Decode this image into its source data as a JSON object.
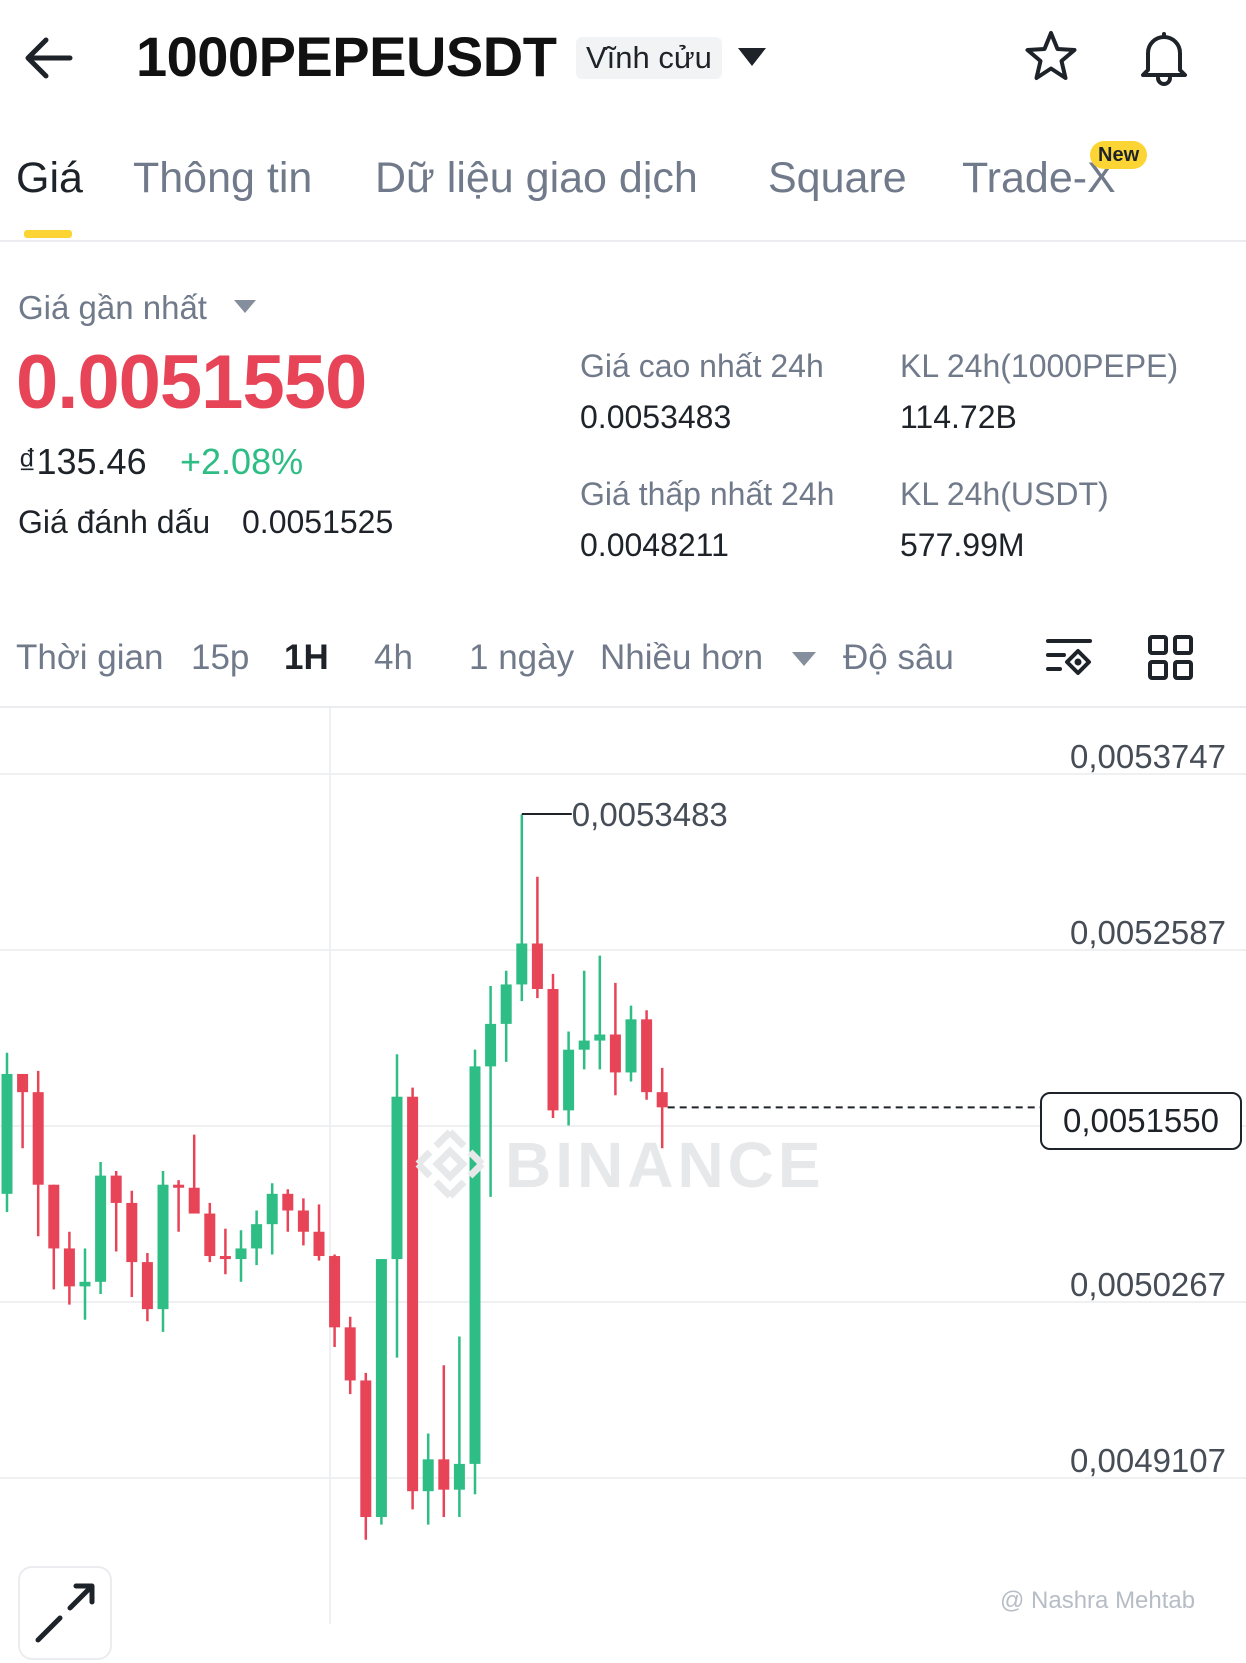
{
  "header": {
    "symbol": "1000PEPEUSDT",
    "contract_type": "Vĩnh cửu",
    "icons": [
      "back-arrow-icon",
      "chevron-down-icon",
      "star-icon",
      "bell-icon"
    ]
  },
  "tabs": [
    {
      "label": "Giá",
      "active": true
    },
    {
      "label": "Thông tin",
      "active": false
    },
    {
      "label": "Dữ liệu giao dịch",
      "active": false
    },
    {
      "label": "Square",
      "active": false
    },
    {
      "label": "Trade-X",
      "active": false,
      "badge": "New"
    }
  ],
  "price": {
    "last_price_label": "Giá gần nhất",
    "last_price": "0.0051550",
    "fiat_price": "₫135.46",
    "change_pct": "+2.08%",
    "mark_label": "Giá đánh dấu",
    "mark_value": "0.0051525"
  },
  "stats": {
    "high_label": "Giá cao nhất 24h",
    "high_value": "0.0053483",
    "low_label": "Giá thấp nhất 24h",
    "low_value": "0.0048211",
    "vol_base_label": "KL 24h(1000PEPE)",
    "vol_base_value": "114.72B",
    "vol_quote_label": "KL 24h(USDT)",
    "vol_quote_value": "577.99M"
  },
  "intervals": {
    "time_label": "Thời gian",
    "options": [
      "15p",
      "1H",
      "4h",
      "1 ngày"
    ],
    "active": "1H",
    "more_label": "Nhiều hơn",
    "depth_label": "Độ sâu"
  },
  "colors": {
    "up": "#2ebd85",
    "down": "#e74458",
    "accent": "#fcd535",
    "text_primary": "#1e2329",
    "text_secondary": "#707a8a"
  },
  "chart_data": {
    "type": "candlestick",
    "y_ticks": [
      "0,0053747",
      "0,0052587",
      "0,0050267",
      "0,0049107"
    ],
    "y_tick_values": [
      0.0053747,
      0.0052587,
      0.0050267,
      0.0049107
    ],
    "high_marker": "0,0053483",
    "current_price": "0,0051550",
    "watermark": "BINANCE",
    "credit": "@ Nashra Mehtab",
    "candles": [
      {
        "o": 0.005098,
        "h": 0.005191,
        "l": 0.005086,
        "c": 0.005177
      },
      {
        "o": 0.005177,
        "h": 0.005165,
        "l": 0.005128,
        "c": 0.005165
      },
      {
        "o": 0.005165,
        "h": 0.005179,
        "l": 0.00507,
        "c": 0.005104
      },
      {
        "o": 0.005104,
        "h": 0.005102,
        "l": 0.005035,
        "c": 0.005062
      },
      {
        "o": 0.005062,
        "h": 0.005073,
        "l": 0.005025,
        "c": 0.005037
      },
      {
        "o": 0.005037,
        "h": 0.005062,
        "l": 0.005015,
        "c": 0.00504
      },
      {
        "o": 0.00504,
        "h": 0.005119,
        "l": 0.005032,
        "c": 0.00511
      },
      {
        "o": 0.00511,
        "h": 0.005113,
        "l": 0.00506,
        "c": 0.005092
      },
      {
        "o": 0.005092,
        "h": 0.0051,
        "l": 0.00503,
        "c": 0.005053
      },
      {
        "o": 0.005053,
        "h": 0.005059,
        "l": 0.005014,
        "c": 0.005022
      },
      {
        "o": 0.005022,
        "h": 0.005113,
        "l": 0.005007,
        "c": 0.005104
      },
      {
        "o": 0.005104,
        "h": 0.005107,
        "l": 0.005073,
        "c": 0.005102
      },
      {
        "o": 0.005102,
        "h": 0.005137,
        "l": 0.00509,
        "c": 0.005085
      },
      {
        "o": 0.005085,
        "h": 0.005092,
        "l": 0.005053,
        "c": 0.005057
      },
      {
        "o": 0.005057,
        "h": 0.005075,
        "l": 0.005045,
        "c": 0.005055
      },
      {
        "o": 0.005055,
        "h": 0.005074,
        "l": 0.00504,
        "c": 0.005062
      },
      {
        "o": 0.005062,
        "h": 0.005087,
        "l": 0.005051,
        "c": 0.005078
      },
      {
        "o": 0.005078,
        "h": 0.005105,
        "l": 0.005058,
        "c": 0.005098
      },
      {
        "o": 0.005098,
        "h": 0.005101,
        "l": 0.005073,
        "c": 0.005087
      },
      {
        "o": 0.005087,
        "h": 0.005095,
        "l": 0.005064,
        "c": 0.005073
      },
      {
        "o": 0.005073,
        "h": 0.005091,
        "l": 0.005054,
        "c": 0.005057
      },
      {
        "o": 0.005057,
        "h": 0.005058,
        "l": 0.004997,
        "c": 0.00501
      },
      {
        "o": 0.00501,
        "h": 0.005017,
        "l": 0.004966,
        "c": 0.004975
      },
      {
        "o": 0.004975,
        "h": 0.00498,
        "l": 0.00487,
        "c": 0.004885
      },
      {
        "o": 0.004885,
        "h": 0.005003,
        "l": 0.00488,
        "c": 0.005055
      },
      {
        "o": 0.005055,
        "h": 0.00519,
        "l": 0.00499,
        "c": 0.005162
      },
      {
        "o": 0.005162,
        "h": 0.005168,
        "l": 0.00489,
        "c": 0.004902
      },
      {
        "o": 0.004902,
        "h": 0.00494,
        "l": 0.00488,
        "c": 0.004923
      },
      {
        "o": 0.004923,
        "h": 0.004985,
        "l": 0.004885,
        "c": 0.004903
      },
      {
        "o": 0.004903,
        "h": 0.005004,
        "l": 0.004885,
        "c": 0.00492
      },
      {
        "o": 0.00492,
        "h": 0.005193,
        "l": 0.0049,
        "c": 0.005182
      },
      {
        "o": 0.005182,
        "h": 0.005235,
        "l": 0.005096,
        "c": 0.00521
      },
      {
        "o": 0.00521,
        "h": 0.005245,
        "l": 0.005185,
        "c": 0.005236
      },
      {
        "o": 0.005236,
        "h": 0.005348,
        "l": 0.005225,
        "c": 0.005263
      },
      {
        "o": 0.005263,
        "h": 0.005307,
        "l": 0.005227,
        "c": 0.005233
      },
      {
        "o": 0.005233,
        "h": 0.005243,
        "l": 0.005148,
        "c": 0.005153
      },
      {
        "o": 0.005153,
        "h": 0.005205,
        "l": 0.005143,
        "c": 0.005193
      },
      {
        "o": 0.005193,
        "h": 0.005245,
        "l": 0.00518,
        "c": 0.005199
      },
      {
        "o": 0.005199,
        "h": 0.005255,
        "l": 0.00518,
        "c": 0.005203
      },
      {
        "o": 0.005203,
        "h": 0.005237,
        "l": 0.005163,
        "c": 0.005178
      },
      {
        "o": 0.005178,
        "h": 0.005222,
        "l": 0.005172,
        "c": 0.005213
      },
      {
        "o": 0.005213,
        "h": 0.005219,
        "l": 0.00516,
        "c": 0.005165
      },
      {
        "o": 0.005165,
        "h": 0.005181,
        "l": 0.005128,
        "c": 0.005155
      }
    ]
  }
}
